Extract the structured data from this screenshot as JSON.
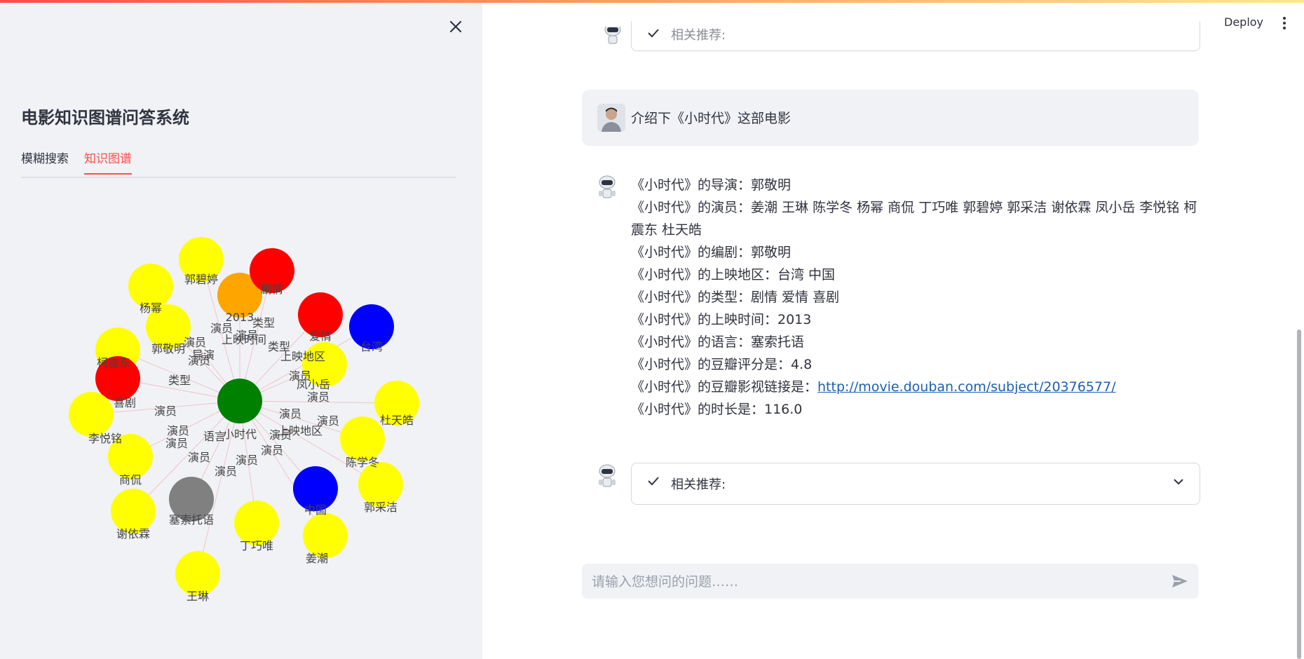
{
  "sidebar": {
    "title": "电影知识图谱问答系统",
    "tabs": [
      {
        "label": "模糊搜索"
      },
      {
        "label": "知识图谱"
      }
    ],
    "graph": {
      "center": {
        "label": "小时代",
        "color": "#008000"
      },
      "edges": [
        "演员",
        "演员",
        "类型",
        "演员",
        "演员",
        "上映时间",
        "导演",
        "类型",
        "演员",
        "上映地区",
        "演员",
        "演员",
        "演员",
        "类型",
        "演员",
        "演员",
        "语言",
        "演员",
        "演员",
        "演员",
        "上映地区",
        "演员",
        "演员",
        "演员"
      ],
      "nodes": [
        {
          "label": "杨幂",
          "color": "#ffff00"
        },
        {
          "label": "郭碧婷",
          "color": "#ffff00"
        },
        {
          "label": "2013",
          "color": "#ffa500"
        },
        {
          "label": "剧情",
          "color": "#ff0000"
        },
        {
          "label": "爱情",
          "color": "#ff0000"
        },
        {
          "label": "台湾",
          "color": "#0000ff"
        },
        {
          "label": "柯震东",
          "color": "#ffff00"
        },
        {
          "label": "郭敬明",
          "color": "#ffff00"
        },
        {
          "label": "喜剧",
          "color": "#ff0000"
        },
        {
          "label": "凤小岳",
          "color": "#ffff00"
        },
        {
          "label": "杜天皓",
          "color": "#ffff00"
        },
        {
          "label": "李悦铭",
          "color": "#ffff00"
        },
        {
          "label": "陈学冬",
          "color": "#ffff00"
        },
        {
          "label": "商侃",
          "color": "#ffff00"
        },
        {
          "label": "塞索托语",
          "color": "#808080"
        },
        {
          "label": "中国",
          "color": "#0000ff"
        },
        {
          "label": "郭采洁",
          "color": "#ffff00"
        },
        {
          "label": "谢依霖",
          "color": "#ffff00"
        },
        {
          "label": "丁巧唯",
          "color": "#ffff00"
        },
        {
          "label": "姜潮",
          "color": "#ffff00"
        },
        {
          "label": "王琳",
          "color": "#ffff00"
        }
      ]
    }
  },
  "header": {
    "deploy_label": "Deploy"
  },
  "chat": {
    "top_expander_label": "相关推荐:",
    "user_message": "介绍下《小时代》这部电影",
    "answer_lines": [
      "《小时代》的导演：郭敬明",
      "《小时代》的演员：姜潮 王琳 陈学冬 杨幂 商侃 丁巧唯 郭碧婷 郭采洁 谢依霖 凤小岳 李悦铭 柯震东 杜天皓",
      "《小时代》的编剧：郭敬明",
      "《小时代》的上映地区：台湾 中国",
      "《小时代》的类型：剧情 爱情 喜剧",
      "《小时代》的上映时间：2013",
      "《小时代》的语言：塞索托语",
      "《小时代》的豆瓣评分是：4.8"
    ],
    "link_prefix": "《小时代》的豆瓣影视链接是：",
    "link_url": "http://movie.douban.com/subject/20376577/",
    "duration_line": "《小时代》的时长是：116.0",
    "expander_label": "相关推荐:",
    "input_placeholder": "请输入您想问的问题……"
  },
  "colors": {
    "accent": "#ff4b4b",
    "sidebar_bg": "#f0f2f6",
    "link": "#1a5fb4"
  }
}
